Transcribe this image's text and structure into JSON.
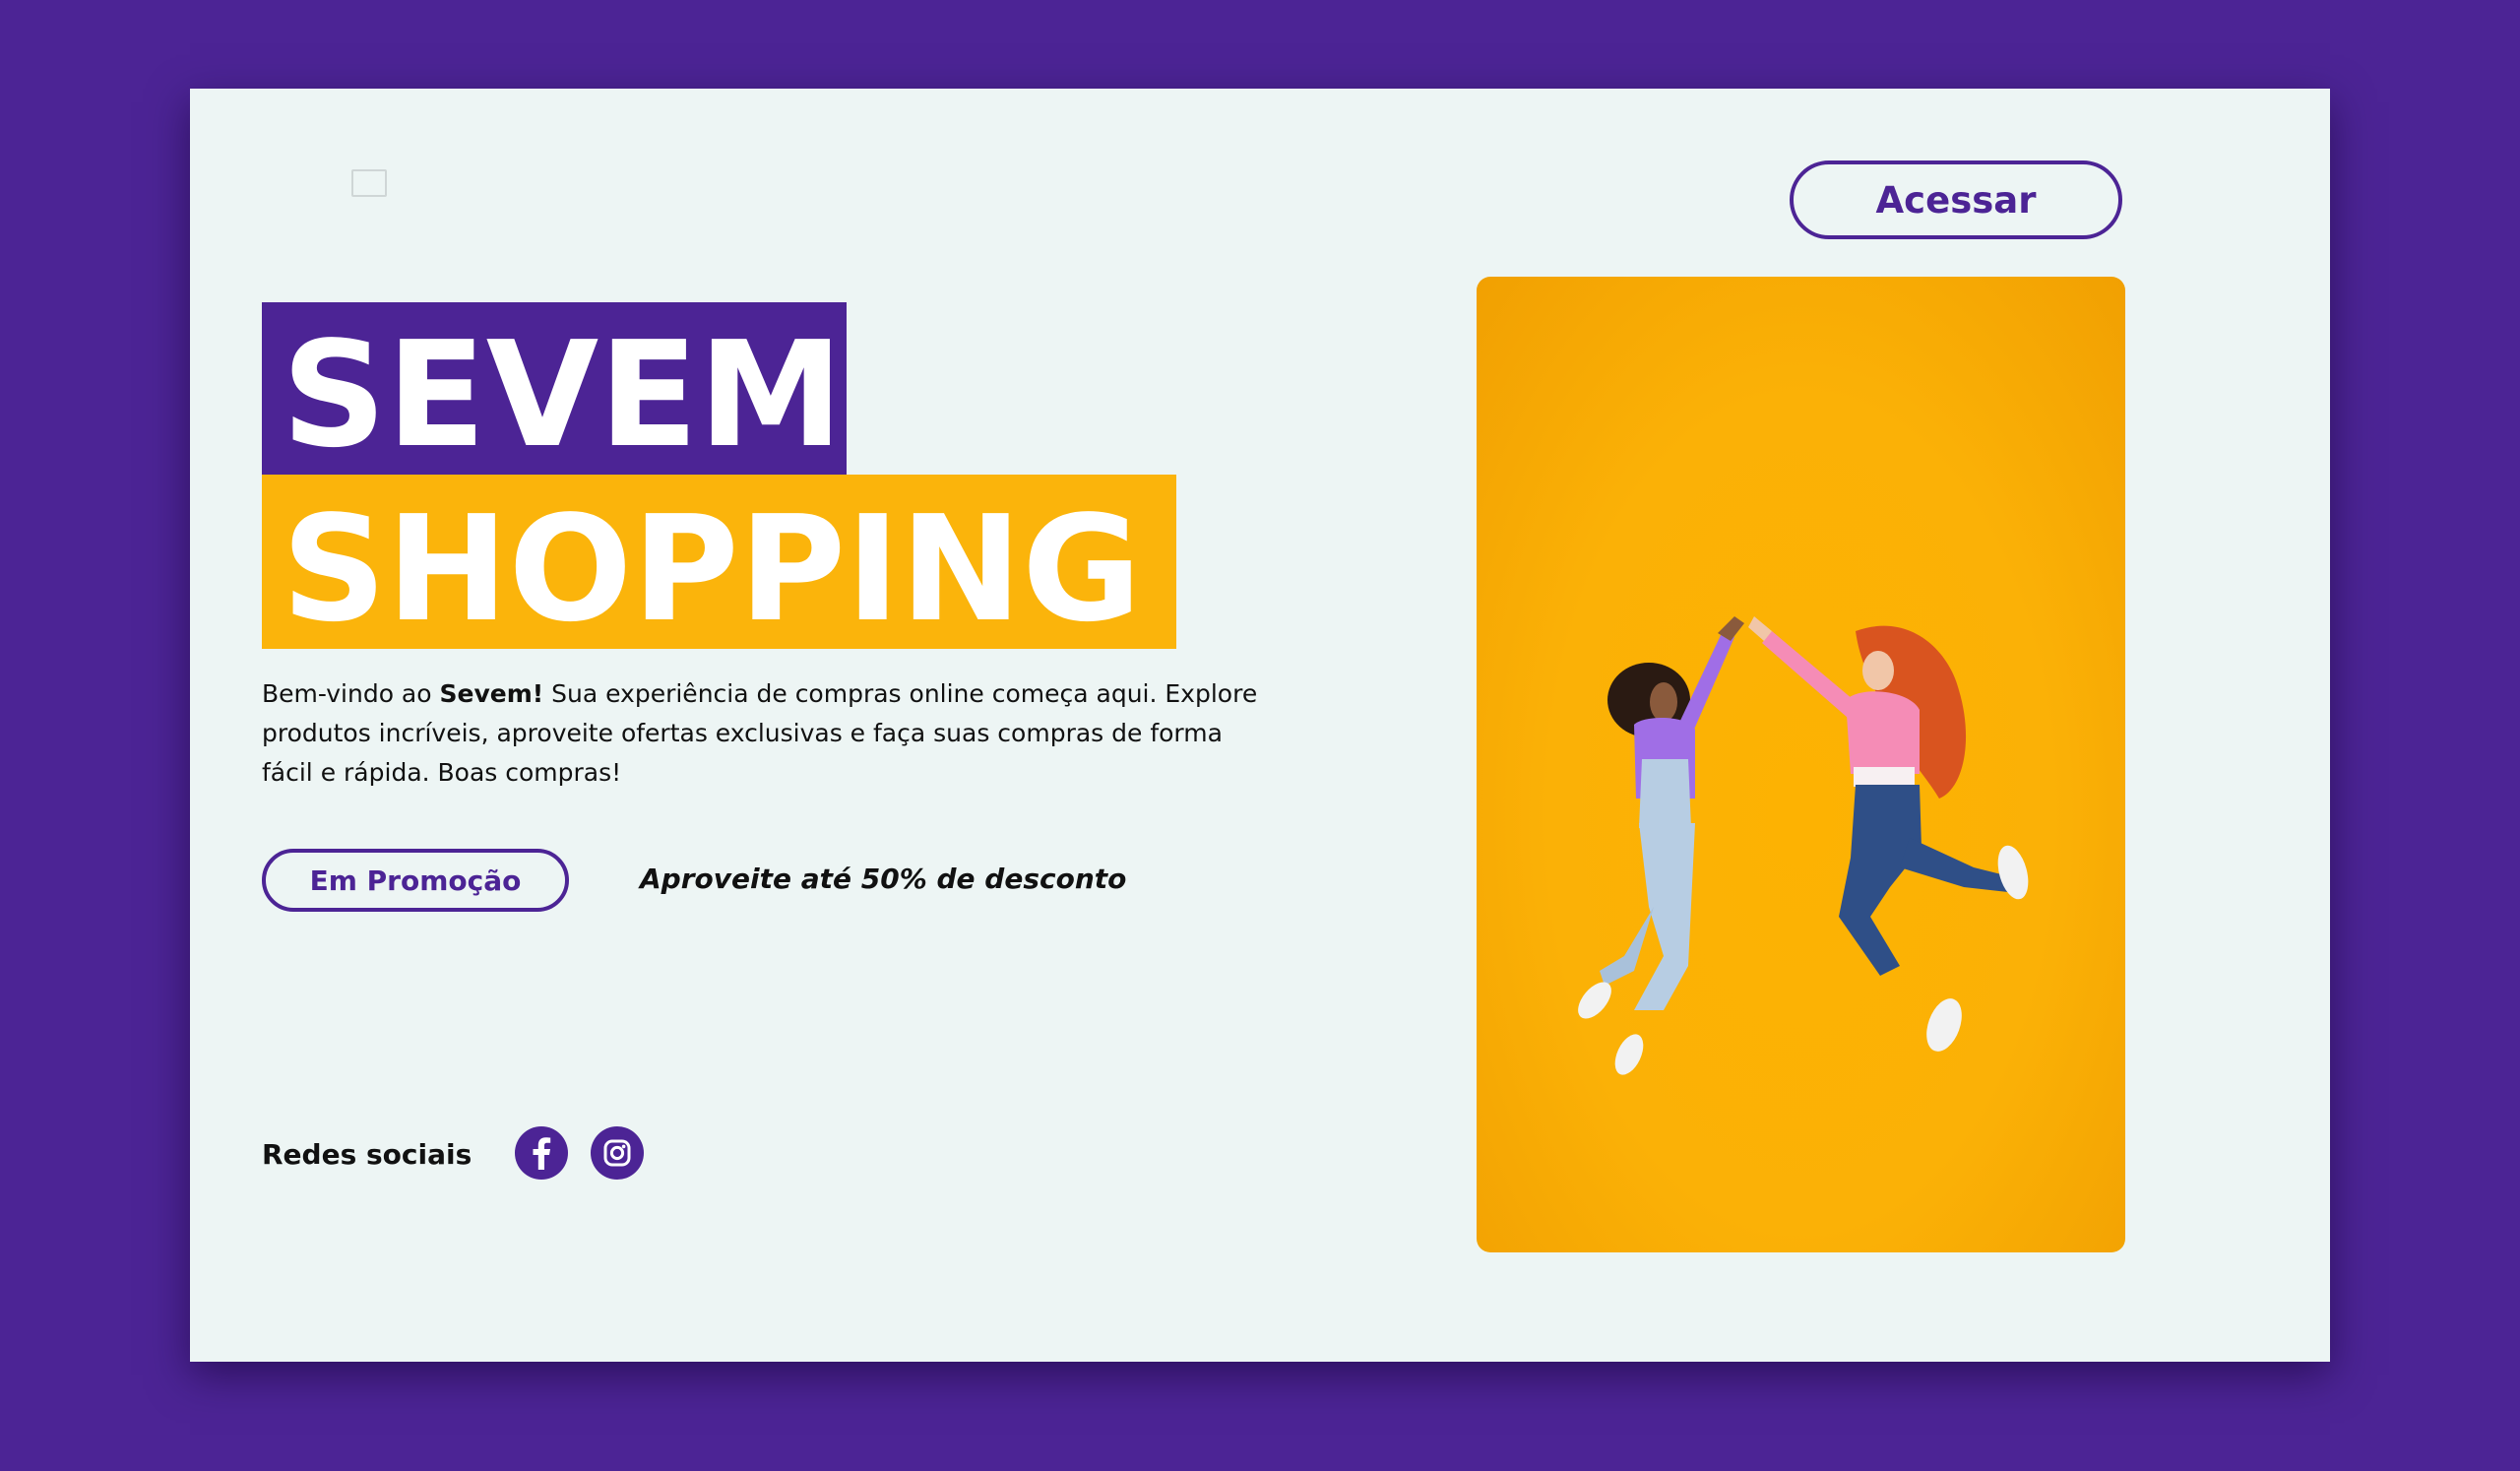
{
  "brand": {
    "title_line_1": "SEVEM",
    "title_line_2": "SHOPPING",
    "colors": {
      "primary": "#4c2495",
      "accent": "#fbb40b",
      "background": "#edf5f4"
    }
  },
  "header": {
    "logo_icon": "broken-image-icon",
    "access_button": "Acessar"
  },
  "intro": {
    "prefix": "Bem-vindo ao ",
    "brand_name": "Sevem!",
    "body": " Sua experiência de compras online começa aqui. Explore produtos incríveis, aproveite ofertas exclusivas e faça suas compras de forma fácil e rápida. Boas compras!"
  },
  "promo": {
    "button_label": "Em Promoção",
    "tagline": "Aproveite até 50% de desconto"
  },
  "social": {
    "label": "Redes sociais",
    "icons": [
      "facebook-icon",
      "instagram-icon"
    ]
  },
  "hero": {
    "image_icon": "two-women-jumping-high-five-photo"
  }
}
